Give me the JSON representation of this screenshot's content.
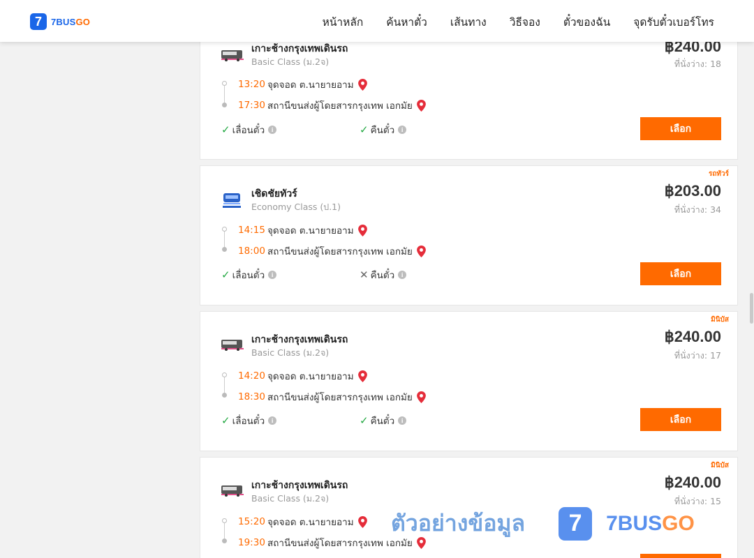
{
  "header": {
    "logo_mark": "7",
    "logo_text_a": "7BUS",
    "logo_text_b": "GO",
    "nav": [
      "หน้าหลัก",
      "ค้นหาตั๋ว",
      "เส้นทาง",
      "วิธีจอง",
      "ตั๋วของฉัน",
      "จุดรับตั๋วเบอร์โทร"
    ]
  },
  "cards": [
    {
      "badge": "",
      "operator": "เกาะช้างกรุงเทพเดินรถ",
      "class": "Basic Class (ม.2จ)",
      "price": "฿240.00",
      "seats": "ที่นั่งว่าง: 18",
      "depart_time": "13:20",
      "depart_place": "จุดจอด ต.นายายอาม",
      "arrive_time": "17:30",
      "arrive_place": "สถานีขนส่งผู้โดยสารกรุงเทพ เอกมัย",
      "feature1": "เลื่อนตั๋ว",
      "feature2": "คืนตั๋ว",
      "select": "เลือก"
    },
    {
      "badge": "รถทัวร์",
      "operator": "เชิดชัยทัวร์",
      "class": "Economy Class (ป.1)",
      "price": "฿203.00",
      "seats": "ที่นั่งว่าง: 34",
      "depart_time": "14:15",
      "depart_place": "จุดจอด ต.นายายอาม",
      "arrive_time": "18:00",
      "arrive_place": "สถานีขนส่งผู้โดยสารกรุงเทพ เอกมัย",
      "feature1": "เลื่อนตั๋ว",
      "feature2": "คืนตั๋ว",
      "select": "เลือก"
    },
    {
      "badge": "มินิบัส",
      "operator": "เกาะช้างกรุงเทพเดินรถ",
      "class": "Basic Class (ม.2จ)",
      "price": "฿240.00",
      "seats": "ที่นั่งว่าง: 17",
      "depart_time": "14:20",
      "depart_place": "จุดจอด ต.นายายอาม",
      "arrive_time": "18:30",
      "arrive_place": "สถานีขนส่งผู้โดยสารกรุงเทพ เอกมัย",
      "feature1": "เลื่อนตั๋ว",
      "feature2": "คืนตั๋ว",
      "select": "เลือก"
    },
    {
      "badge": "มินิบัส",
      "operator": "เกาะช้างกรุงเทพเดินรถ",
      "class": "Basic Class (ม.2จ)",
      "price": "฿240.00",
      "seats": "ที่นั่งว่าง: 15",
      "depart_time": "15:20",
      "depart_place": "จุดจอด ต.นายายอาม",
      "arrive_time": "19:30",
      "arrive_place": "สถานีขนส่งผู้โดยสารกรุงเทพ เอกมัย"
    }
  ],
  "watermark": {
    "text": "ตัวอย่างข้อมูล",
    "logo_mark": "7",
    "brand_a": "7BUS",
    "brand_b": "GO"
  },
  "colors": {
    "brand_blue": "#1a66e8",
    "accent_orange": "#ff6a00",
    "ok_green": "#23a842"
  }
}
